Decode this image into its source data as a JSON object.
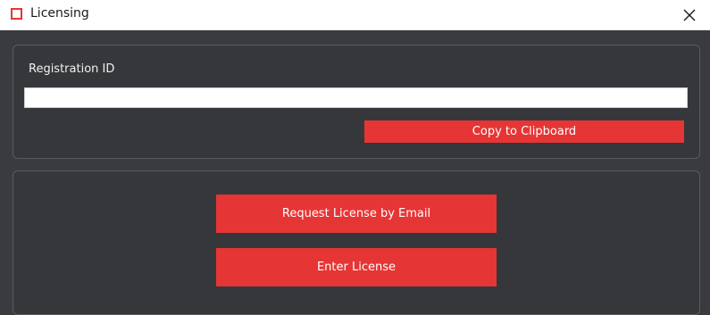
{
  "window": {
    "title": "Licensing",
    "icon": "app-square-icon",
    "close_icon": "close-icon",
    "accent_color": "#e63535"
  },
  "registration": {
    "label": "Registration ID",
    "value": "",
    "copy_button": "Copy to Clipboard"
  },
  "actions": {
    "request_button": "Request License by Email",
    "enter_button": "Enter License"
  }
}
